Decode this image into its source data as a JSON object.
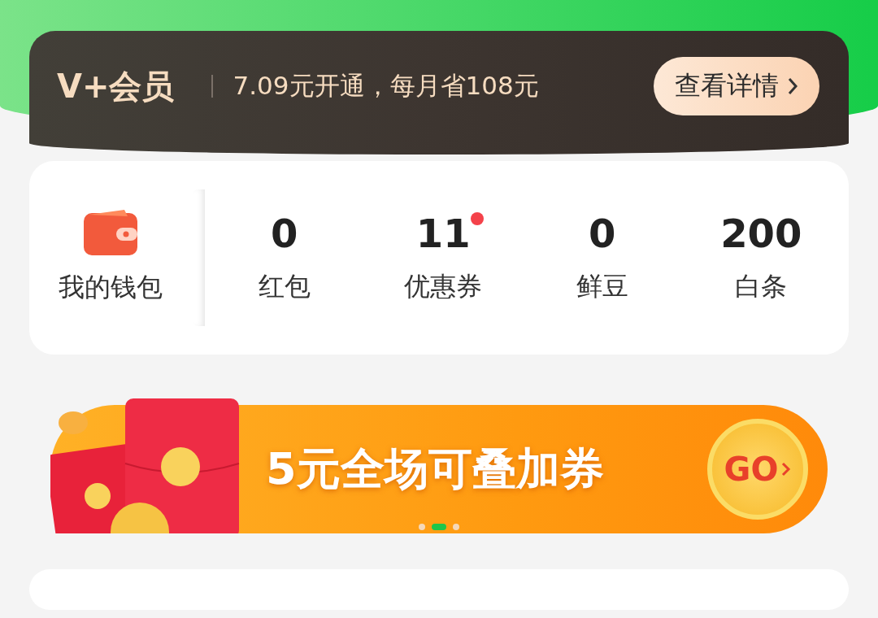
{
  "member": {
    "logo": "V+会员",
    "promo": "7.09元开通，每月省108元",
    "button": "查看详情"
  },
  "wallet": {
    "label": "我的钱包",
    "stats": [
      {
        "value": "0",
        "label": "红包",
        "dot": false
      },
      {
        "value": "11",
        "label": "优惠券",
        "dot": true
      },
      {
        "value": "0",
        "label": "鲜豆",
        "dot": false
      },
      {
        "value": "200",
        "label": "白条",
        "dot": false
      }
    ]
  },
  "banner": {
    "text": "5元全场可叠加券",
    "go": "GO",
    "dots": [
      {
        "selected": false
      },
      {
        "selected": true
      },
      {
        "selected": false
      }
    ]
  }
}
